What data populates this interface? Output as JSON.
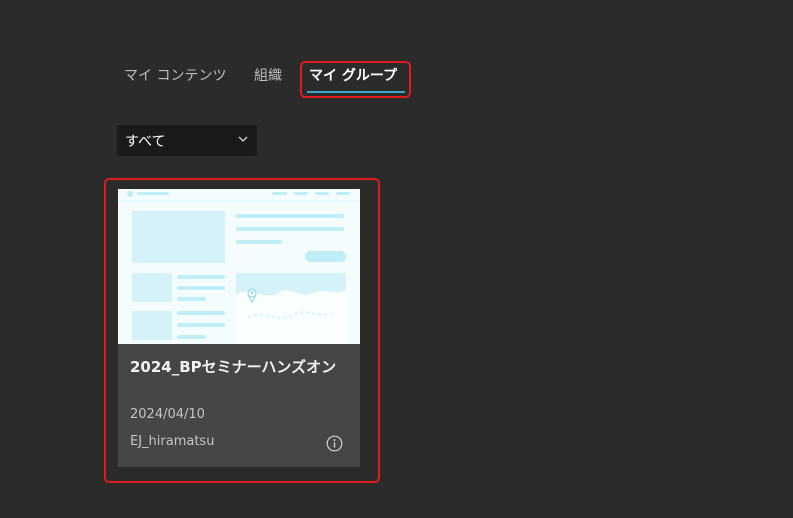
{
  "tabs": [
    {
      "label": "マイ コンテンツ",
      "selected": false
    },
    {
      "label": "組織",
      "selected": false
    },
    {
      "label": "マイ グループ",
      "selected": true
    }
  ],
  "filter": {
    "value": "すべて"
  },
  "card": {
    "title": "2024_BPセミナーハンズオン",
    "date": "2024/04/10",
    "owner": "EJ_hiramatsu"
  },
  "colors": {
    "background": "#2b2b2b",
    "tab_underline": "#3aa3c9",
    "highlight_border": "#e01b1b",
    "card_background": "#464646",
    "thumbnail_accent": "#bfeef6"
  },
  "icons": {
    "filter": "chevron-down-icon",
    "card_info": "info-icon",
    "thumbnail_pin": "location-pin-icon"
  }
}
